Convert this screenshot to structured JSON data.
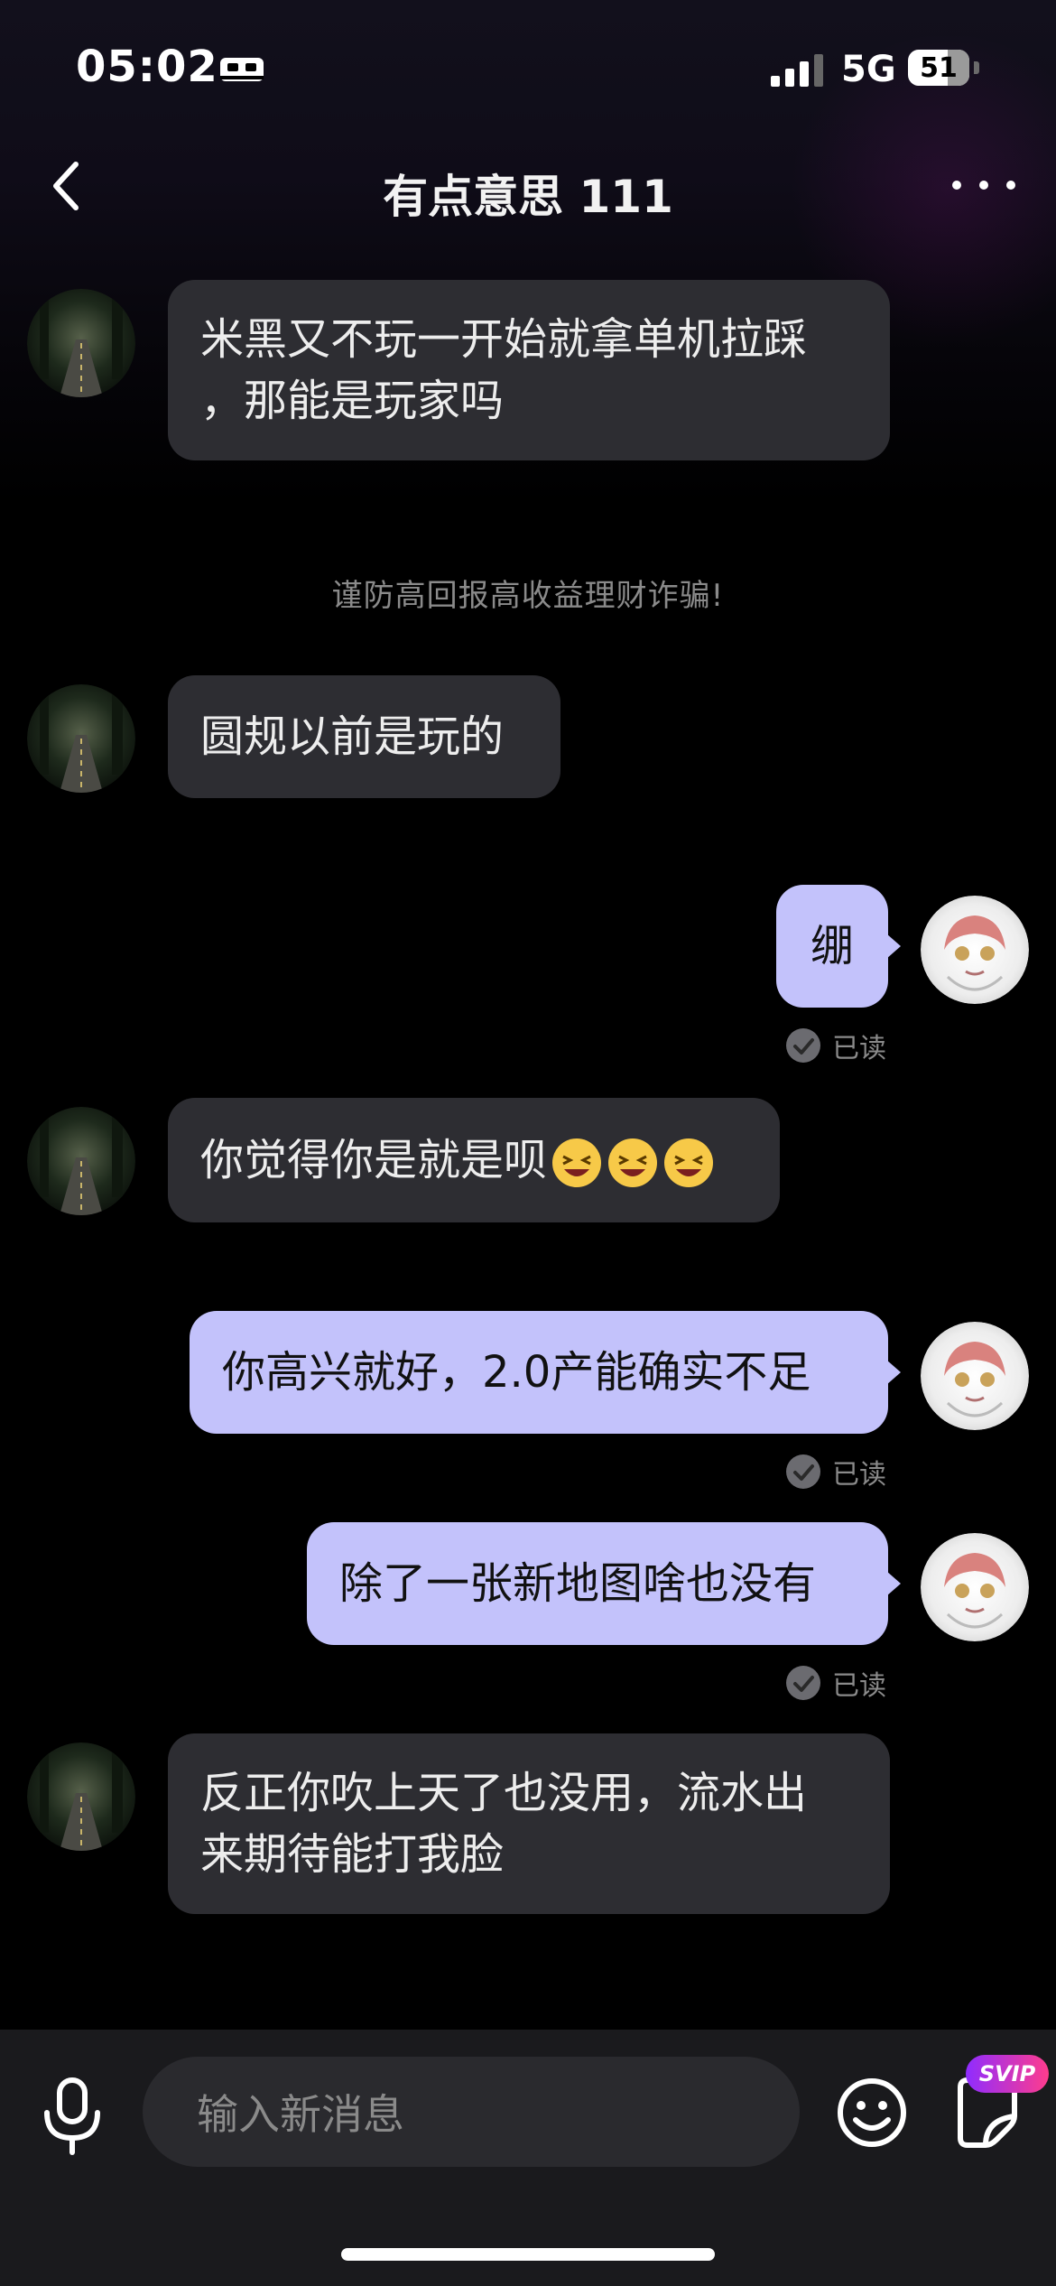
{
  "status_bar": {
    "time": "05:02",
    "network": "5G",
    "battery": "51"
  },
  "header": {
    "title": "有点意思 111"
  },
  "messages": [
    {
      "side": "in",
      "text_lines": [
        "米黑又不玩一开始就拿单机拉踩",
        "，那能是玩家吗"
      ]
    },
    {
      "side": "in",
      "text": "圆规以前是玩的"
    },
    {
      "side": "out",
      "text": "绷",
      "status": "已读"
    },
    {
      "side": "in",
      "text": "你觉得你是就是呗"
    },
    {
      "side": "out",
      "text": "你高兴就好，2.0产能确实不足",
      "status": "已读"
    },
    {
      "side": "out",
      "text": "除了一张新地图啥也没有",
      "status": "已读"
    },
    {
      "side": "in",
      "text_lines": [
        "反正你吹上天了也没用，流水出",
        "来期待能打我脸"
      ]
    }
  ],
  "notice": "谨防高回报高收益理财诈骗!",
  "composer": {
    "placeholder": "输入新消息",
    "svip": "SVIP"
  },
  "colors": {
    "incoming_bubble": "#2d2d32",
    "outgoing_bubble": "#c3c2fb",
    "background": "#000000"
  },
  "icons": [
    "sleep-icon",
    "signal-icon",
    "back-icon",
    "more-icon",
    "microphone-icon",
    "smile-icon",
    "sticker-icon",
    "read-check-icon"
  ]
}
